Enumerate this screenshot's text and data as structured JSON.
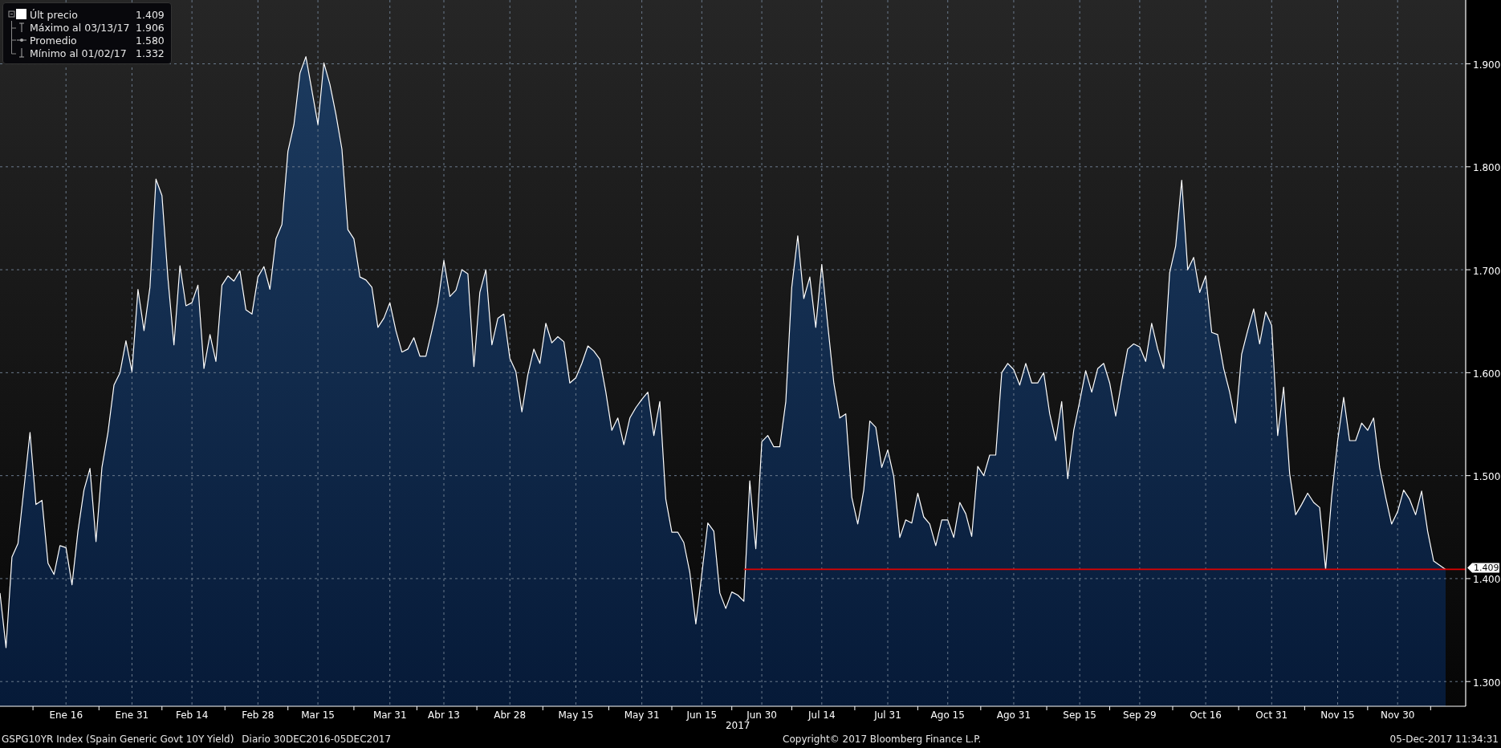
{
  "chart": {
    "legend": {
      "items": [
        {
          "kind": "last",
          "label": "Últ precio",
          "value": "1.409"
        },
        {
          "kind": "max",
          "label": "Máximo al 03/13/17",
          "value": "1.906"
        },
        {
          "kind": "average",
          "label": "Promedio",
          "value": "1.580"
        },
        {
          "kind": "min",
          "label": "Mínimo al 01/02/17",
          "value": "1.332"
        }
      ]
    },
    "chart_data": {
      "type": "area",
      "xlabel": "2017",
      "categories": [
        null,
        null,
        null,
        null,
        null,
        null,
        null,
        null,
        null,
        null,
        null,
        "Ene 16",
        null,
        null,
        null,
        null,
        null,
        null,
        null,
        null,
        null,
        null,
        "Ene 31",
        null,
        null,
        null,
        null,
        null,
        null,
        null,
        null,
        null,
        "Feb 14",
        null,
        null,
        null,
        null,
        null,
        null,
        null,
        null,
        null,
        null,
        "Feb 28",
        null,
        null,
        null,
        null,
        null,
        null,
        null,
        null,
        null,
        "Mar 15",
        null,
        null,
        null,
        null,
        null,
        null,
        null,
        null,
        null,
        null,
        null,
        "Mar 31",
        null,
        null,
        null,
        null,
        null,
        null,
        null,
        null,
        "Abr 13",
        null,
        null,
        null,
        null,
        null,
        null,
        null,
        null,
        null,
        null,
        "Abr 28",
        null,
        null,
        null,
        null,
        null,
        null,
        null,
        null,
        null,
        null,
        "May 15",
        null,
        null,
        null,
        null,
        null,
        null,
        null,
        null,
        null,
        null,
        "May 31",
        null,
        null,
        null,
        null,
        null,
        null,
        null,
        null,
        null,
        "Jun 15",
        null,
        null,
        null,
        null,
        null,
        null,
        null,
        null,
        null,
        "Jun 30",
        null,
        null,
        null,
        null,
        null,
        null,
        null,
        null,
        null,
        "Jul 14",
        null,
        null,
        null,
        null,
        null,
        null,
        null,
        null,
        null,
        null,
        "Jul 31",
        null,
        null,
        null,
        null,
        null,
        null,
        null,
        null,
        null,
        "Ago 15",
        null,
        null,
        null,
        null,
        null,
        null,
        null,
        null,
        null,
        null,
        "Ago 31",
        null,
        null,
        null,
        null,
        null,
        null,
        null,
        null,
        null,
        null,
        "Sep 15",
        null,
        null,
        null,
        null,
        null,
        null,
        null,
        null,
        null,
        "Sep 29",
        null,
        null,
        null,
        null,
        null,
        null,
        null,
        null,
        null,
        null,
        "Oct 16",
        null,
        null,
        null,
        null,
        null,
        null,
        null,
        null,
        null,
        null,
        "Oct 31",
        null,
        null,
        null,
        null,
        null,
        null,
        null,
        null,
        null,
        null,
        "Nov 15",
        null,
        null,
        null,
        null,
        null,
        null,
        null,
        null,
        null,
        "Nov 30",
        null,
        null,
        null,
        null,
        null,
        null,
        null,
        null
      ],
      "values": [
        1.386,
        1.333,
        1.421,
        1.434,
        1.488,
        1.542,
        1.472,
        1.476,
        1.415,
        1.404,
        1.432,
        1.43,
        1.394,
        1.446,
        1.486,
        1.507,
        1.436,
        1.508,
        1.542,
        1.588,
        1.6,
        1.631,
        1.601,
        1.681,
        1.641,
        1.683,
        1.788,
        1.772,
        1.692,
        1.627,
        1.704,
        1.665,
        1.668,
        1.685,
        1.604,
        1.637,
        1.611,
        1.685,
        1.694,
        1.689,
        1.699,
        1.661,
        1.657,
        1.693,
        1.703,
        1.681,
        1.73,
        1.744,
        1.815,
        1.841,
        1.891,
        1.907,
        1.874,
        1.841,
        1.901,
        1.88,
        1.851,
        1.817,
        1.739,
        1.73,
        1.693,
        1.69,
        1.683,
        1.644,
        1.653,
        1.668,
        1.641,
        1.62,
        1.623,
        1.634,
        1.616,
        1.616,
        1.641,
        1.667,
        1.709,
        1.674,
        1.68,
        1.7,
        1.696,
        1.606,
        1.678,
        1.7,
        1.627,
        1.653,
        1.657,
        1.614,
        1.601,
        1.562,
        1.598,
        1.623,
        1.609,
        1.648,
        1.629,
        1.635,
        1.63,
        1.59,
        1.595,
        1.609,
        1.626,
        1.621,
        1.613,
        1.581,
        1.544,
        1.556,
        1.53,
        1.556,
        1.566,
        1.574,
        1.581,
        1.539,
        1.572,
        1.477,
        1.445,
        1.445,
        1.435,
        1.406,
        1.356,
        1.404,
        1.454,
        1.446,
        1.386,
        1.371,
        1.387,
        1.384,
        1.378,
        1.495,
        1.429,
        1.533,
        1.539,
        1.528,
        1.528,
        1.572,
        1.683,
        1.733,
        1.672,
        1.693,
        1.644,
        1.705,
        1.646,
        1.59,
        1.556,
        1.56,
        1.479,
        1.453,
        1.486,
        1.553,
        1.547,
        1.508,
        1.525,
        1.499,
        1.44,
        1.457,
        1.454,
        1.483,
        1.46,
        1.453,
        1.432,
        1.457,
        1.457,
        1.44,
        1.474,
        1.463,
        1.441,
        1.509,
        1.5,
        1.52,
        1.52,
        1.6,
        1.609,
        1.603,
        1.588,
        1.609,
        1.59,
        1.59,
        1.6,
        1.56,
        1.534,
        1.572,
        1.497,
        1.544,
        1.572,
        1.602,
        1.581,
        1.604,
        1.609,
        1.59,
        1.558,
        1.592,
        1.623,
        1.628,
        1.625,
        1.611,
        1.648,
        1.623,
        1.604,
        1.697,
        1.723,
        1.787,
        1.7,
        1.712,
        1.678,
        1.694,
        1.639,
        1.637,
        1.604,
        1.581,
        1.551,
        1.618,
        1.641,
        1.662,
        1.628,
        1.659,
        1.646,
        1.539,
        1.586,
        1.502,
        1.462,
        1.472,
        1.483,
        1.474,
        1.469,
        1.409,
        1.479,
        1.534,
        1.576,
        1.534,
        1.534,
        1.551,
        1.544,
        1.556,
        1.508,
        1.479,
        1.453,
        1.465,
        1.486,
        1.477,
        1.462,
        1.485,
        1.446,
        1.417,
        1.413,
        1.409
      ],
      "ylim": [
        1.276,
        1.962
      ],
      "yticks": [
        {
          "value": 1.3,
          "label": "1.300"
        },
        {
          "value": 1.4,
          "label": "1.400"
        },
        {
          "value": 1.5,
          "label": "1.500"
        },
        {
          "value": 1.6,
          "label": "1.600"
        },
        {
          "value": 1.7,
          "label": "1.700"
        },
        {
          "value": 1.8,
          "label": "1.800"
        },
        {
          "value": 1.9,
          "label": "1.900"
        }
      ],
      "grid": true,
      "ref_lines": [
        {
          "axis": "y",
          "value": 1.409,
          "label": "1.409",
          "color": "#e00000"
        }
      ]
    }
  },
  "footer": {
    "series": "GSPG10YR Index (Spain Generic Govt 10Y Yield)",
    "period": "Diario 30DEC2016-05DEC2017",
    "copyright": "Copyright© 2017 Bloomberg Finance L.P.",
    "timestamp": "05-Dec-2017 11:34:31"
  }
}
